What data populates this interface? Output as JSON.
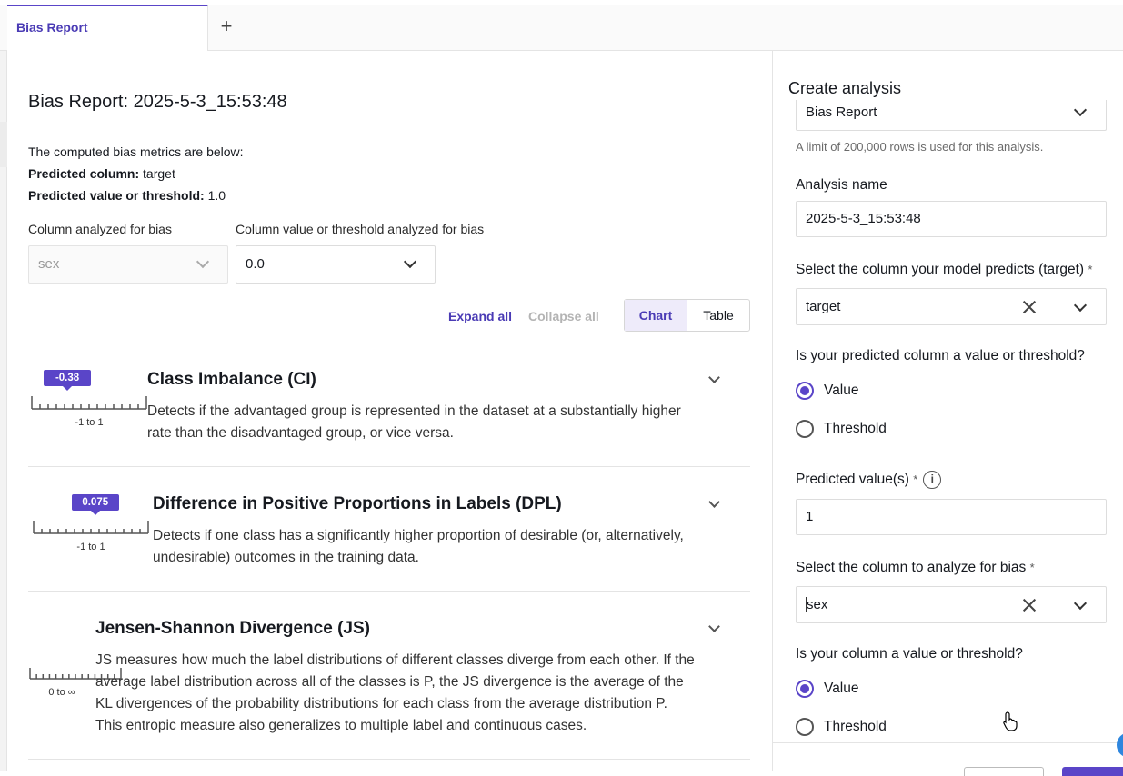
{
  "tabs": [
    {
      "label": "Bias Report"
    }
  ],
  "add_tab_glyph": "+",
  "report": {
    "title": "Bias Report: 2025-5-3_15:53:48",
    "intro": "The computed bias metrics are below:",
    "predicted_column_label": "Predicted column:",
    "predicted_column_value": "target",
    "predicted_value_label": "Predicted value or threshold:",
    "predicted_value_value": "1.0",
    "col_analyzed_label": "Column analyzed for bias",
    "col_analyzed_value": "sex",
    "col_value_label": "Column value or threshold analyzed for bias",
    "col_value_value": "0.0",
    "expand_all": "Expand all",
    "collapse_all": "Collapse all",
    "view_chart": "Chart",
    "view_table": "Table"
  },
  "metrics": [
    {
      "title": "Class Imbalance (CI)",
      "value": -0.38,
      "value_label": "-0.38",
      "range": "-1 to 1",
      "range_min": -1,
      "range_max": 1,
      "description_lines": [
        "Detects if the advantaged group is represented in the dataset at a substantially higher",
        "rate than the disadvantaged group, or vice versa."
      ]
    },
    {
      "title": "Difference in Positive Proportions in Labels (DPL)",
      "value": 0.075,
      "value_label": "0.075",
      "range": "-1 to 1",
      "range_min": -1,
      "range_max": 1,
      "description_lines": [
        "Detects if one class has a significantly higher proportion of desirable (or, alternatively,",
        "undesirable) outcomes in the training data."
      ]
    },
    {
      "title": "Jensen-Shannon Divergence (JS)",
      "value_label": "",
      "range": "0 to ∞",
      "description_lines": [
        "JS measures how much the label distributions of different classes diverge from each other. If the",
        "average label distribution across all of the classes is P, the JS divergence is the average of the",
        "KL divergences of the probability distributions for each class from the average distribution P.",
        "This entropic measure also generalizes to multiple label and continuous cases."
      ]
    }
  ],
  "panel": {
    "title": "Create analysis",
    "analysis_type": "Bias Report",
    "row_limit_hint": "A limit of 200,000 rows is used for this analysis.",
    "analysis_name_label": "Analysis name",
    "analysis_name_value": "2025-5-3_15:53:48",
    "target_label": "Select the column your model predicts (target)",
    "required_mark": "*",
    "target_value": "target",
    "pred_type_label": "Is your predicted column a value or threshold?",
    "opt_value": "Value",
    "opt_threshold": "Threshold",
    "pred_values_label": "Predicted value(s)",
    "info_glyph": "i",
    "pred_values_value": "1",
    "bias_col_label": "Select the column to analyze for bias",
    "bias_col_value": "sex",
    "col_type_label": "Is your column a value or threshold?"
  }
}
